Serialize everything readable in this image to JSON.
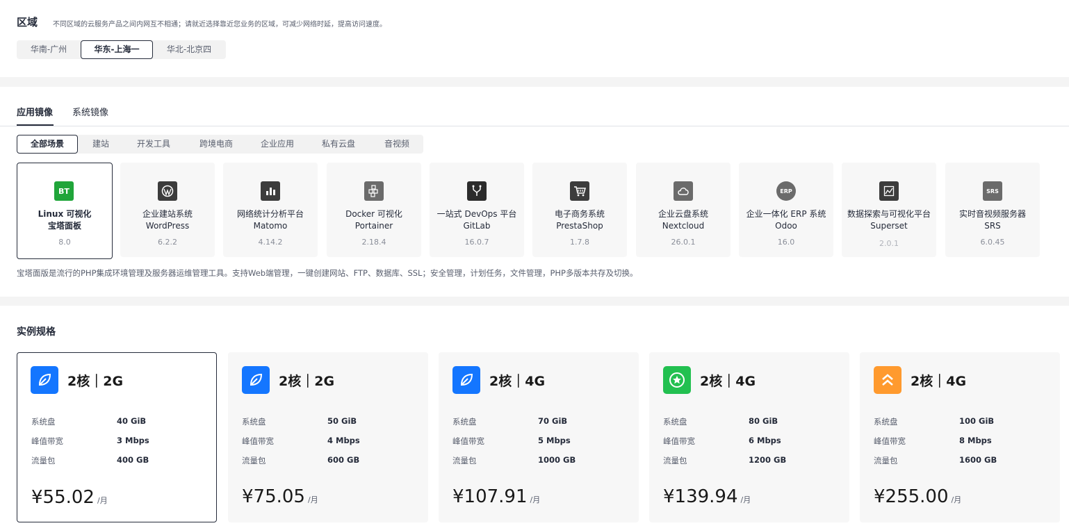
{
  "region": {
    "title": "区域",
    "description": "不同区域的云服务产品之间内网互不相通；请就近选择靠近您业务的区域，可减少网络时延，提高访问速度。",
    "options": [
      "华南-广州",
      "华东-上海一",
      "华北-北京四"
    ],
    "selected": "华东-上海一"
  },
  "image_tabs": [
    "应用镜像",
    "系统镜像"
  ],
  "categories": [
    "全部场景",
    "建站",
    "开发工具",
    "跨境电商",
    "企业应用",
    "私有云盘",
    "音视频"
  ],
  "images": [
    {
      "line1": "Linux 可视化",
      "line2": "宝塔面板",
      "version": "8.0",
      "icon": "bt-panel-icon",
      "icon_text": "BT",
      "color": "#20a53a"
    },
    {
      "line1": "企业建站系统",
      "line2": "WordPress",
      "version": "6.2.2",
      "icon": "wordpress-icon",
      "icon_text": "",
      "color": "#3c3c3c"
    },
    {
      "line1": "网络统计分析平台",
      "line2": "Matomo",
      "version": "4.14.2",
      "icon": "matomo-icon",
      "icon_text": "",
      "color": "#3c3c3c"
    },
    {
      "line1": "Docker 可视化",
      "line2": "Portainer",
      "version": "2.18.4",
      "icon": "docker-icon",
      "icon_text": "",
      "color": "#6b6b6b"
    },
    {
      "line1": "一站式 DevOps 平台",
      "line2": "GitLab",
      "version": "16.0.7",
      "icon": "gitlab-icon",
      "icon_text": "",
      "color": "#2c2c2c"
    },
    {
      "line1": "电子商务系统",
      "line2": "PrestaShop",
      "version": "1.7.8",
      "icon": "cart-icon",
      "icon_text": "",
      "color": "#3c3c3c"
    },
    {
      "line1": "企业云盘系统",
      "line2": "Nextcloud",
      "version": "26.0.1",
      "icon": "cloud-icon",
      "icon_text": "",
      "color": "#6b6b6b"
    },
    {
      "line1": "企业一体化 ERP 系统",
      "line2": "Odoo",
      "version": "16.0",
      "icon": "erp-icon",
      "icon_text": "ERP",
      "color": "#6b6b6b"
    },
    {
      "line1": "数据探索与可视化平台",
      "line2": "Superset",
      "version": "2.0.1",
      "icon": "chart-icon",
      "icon_text": "",
      "color": "#3c3c3c"
    },
    {
      "line1": "实时音视频服务器",
      "line2": "SRS",
      "version": "6.0.45",
      "icon": "srs-icon",
      "icon_text": "SRS",
      "color": "#6b6b6b"
    }
  ],
  "image_description": "宝塔面版是流行的PHP集成环境管理及服务器运维管理工具。支持Web端管理，一键创建网站、FTP、数据库、SSL；安全管理，计划任务，文件管理，PHP多版本共存及切换。",
  "spec_title": "实例规格",
  "spec_labels": {
    "disk": "系统盘",
    "bandwidth": "峰值带宽",
    "traffic": "流量包",
    "per_month": "/月"
  },
  "specs": [
    {
      "title": "2核｜2G",
      "disk": "40 GiB",
      "bandwidth": "3 Mbps",
      "traffic": "400 GB",
      "price": "¥55.02",
      "icon": "leaf-icon",
      "color": "#1476ff"
    },
    {
      "title": "2核｜2G",
      "disk": "50 GiB",
      "bandwidth": "4 Mbps",
      "traffic": "600 GB",
      "price": "¥75.05",
      "icon": "leaf-icon",
      "color": "#1476ff"
    },
    {
      "title": "2核｜4G",
      "disk": "70 GiB",
      "bandwidth": "5 Mbps",
      "traffic": "1000 GB",
      "price": "¥107.91",
      "icon": "leaf-icon",
      "color": "#1476ff"
    },
    {
      "title": "2核｜4G",
      "disk": "80 GiB",
      "bandwidth": "6 Mbps",
      "traffic": "1200 GB",
      "price": "¥139.94",
      "icon": "star-icon",
      "color": "#22c050"
    },
    {
      "title": "2核｜4G",
      "disk": "100 GiB",
      "bandwidth": "8 Mbps",
      "traffic": "1600 GB",
      "price": "¥255.00",
      "icon": "chevrons-up-icon",
      "color": "#ff9a2e"
    }
  ]
}
